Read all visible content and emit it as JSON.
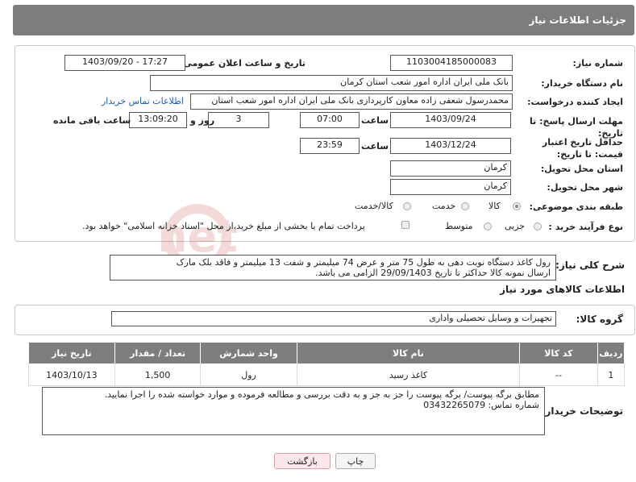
{
  "header": {
    "title": "جزئیات اطلاعات نیاز"
  },
  "form": {
    "need_number_label": "شماره نیاز:",
    "need_number": "1103004185000083",
    "announce_label": "تاریخ و ساعت اعلان عمومی:",
    "announce_value": "1403/09/20 - 17:27",
    "buyer_org_label": "نام دستگاه خریدار:",
    "buyer_org": "بانک ملی ایران اداره امور شعب استان کرمان",
    "requester_label": "ایجاد کننده درخواست:",
    "requester": "محمدرسول شعفی زاده معاون کارپردازی بانک ملی ایران اداره امور شعب استان",
    "contact_link": "اطلاعات تماس خریدار",
    "deadline_label": "مهلت ارسال پاسخ: تا تاریخ:",
    "deadline_date": "1403/09/24",
    "time_label": "ساعت",
    "deadline_time": "07:00",
    "days_value": "3",
    "days_label": "روز و",
    "remaining_time": "13:09:20",
    "remaining_label": "ساعت باقی مانده",
    "min_price_label": "حداقل تاریخ اعتبار قیمت: تا تاریخ:",
    "min_price_date": "1403/12/24",
    "min_price_time": "23:59",
    "province_label": "استان محل تحویل:",
    "province": "کرمان",
    "city_label": "شهر محل تحویل:",
    "city": "کرمان",
    "category_label": "طبقه بندی موضوعی:",
    "category_options": [
      "کالا",
      "خدمت",
      "کالا/خدمت"
    ],
    "process_label": "نوع فرآیند خرید :",
    "process_options": [
      "جزیی",
      "متوسط"
    ],
    "payment_note": "پرداخت تمام یا بخشی از مبلغ خرید،از محل \"اسناد خزانه اسلامی\" خواهد بود."
  },
  "summary": {
    "label": "شرح کلی نیاز:",
    "text_line1": "رول کاغذ دستگاه نوبت دهی به طول 75 متر و عرض 74 میلیمتر و شفت 13 میلیمتر و فاقد بلک مارک",
    "text_line2": "ارسال نمونه کالا حداکثر تا تاریخ 29/09/1403 الزامی می باشد."
  },
  "goods": {
    "section_title": "اطلاعات کالاهای مورد نیاز",
    "group_label": "گروه کالا:",
    "group_value": "تجهیزات و وسایل تحصیلی واداری",
    "columns": [
      "ردیف",
      "کد کالا",
      "نام کالا",
      "واحد شمارش",
      "تعداد / مقدار",
      "تاریخ نیاز"
    ],
    "rows": [
      {
        "row": "1",
        "code": "--",
        "name": "کاغذ رسید",
        "unit": "رول",
        "qty": "1,500",
        "date": "1403/10/13"
      }
    ]
  },
  "buyer_notes": {
    "label": "توضیحات خریدار:",
    "line1": "مطابق برگه پیوست/ برگه پیوست را جز به جز و به دقت بررسی و مطالعه فرموده و موارد خواسته شده را اجرا نمایید.",
    "line2": "شماره تماس: 03432265079"
  },
  "buttons": {
    "print": "چاپ",
    "back": "بازگشت"
  },
  "watermark": {
    "text": "AriaTender.net"
  },
  "colors": {
    "header_bg": "#7d7d7d",
    "link": "#1a5fb4",
    "back_btn_bg": "#fde7ea"
  }
}
